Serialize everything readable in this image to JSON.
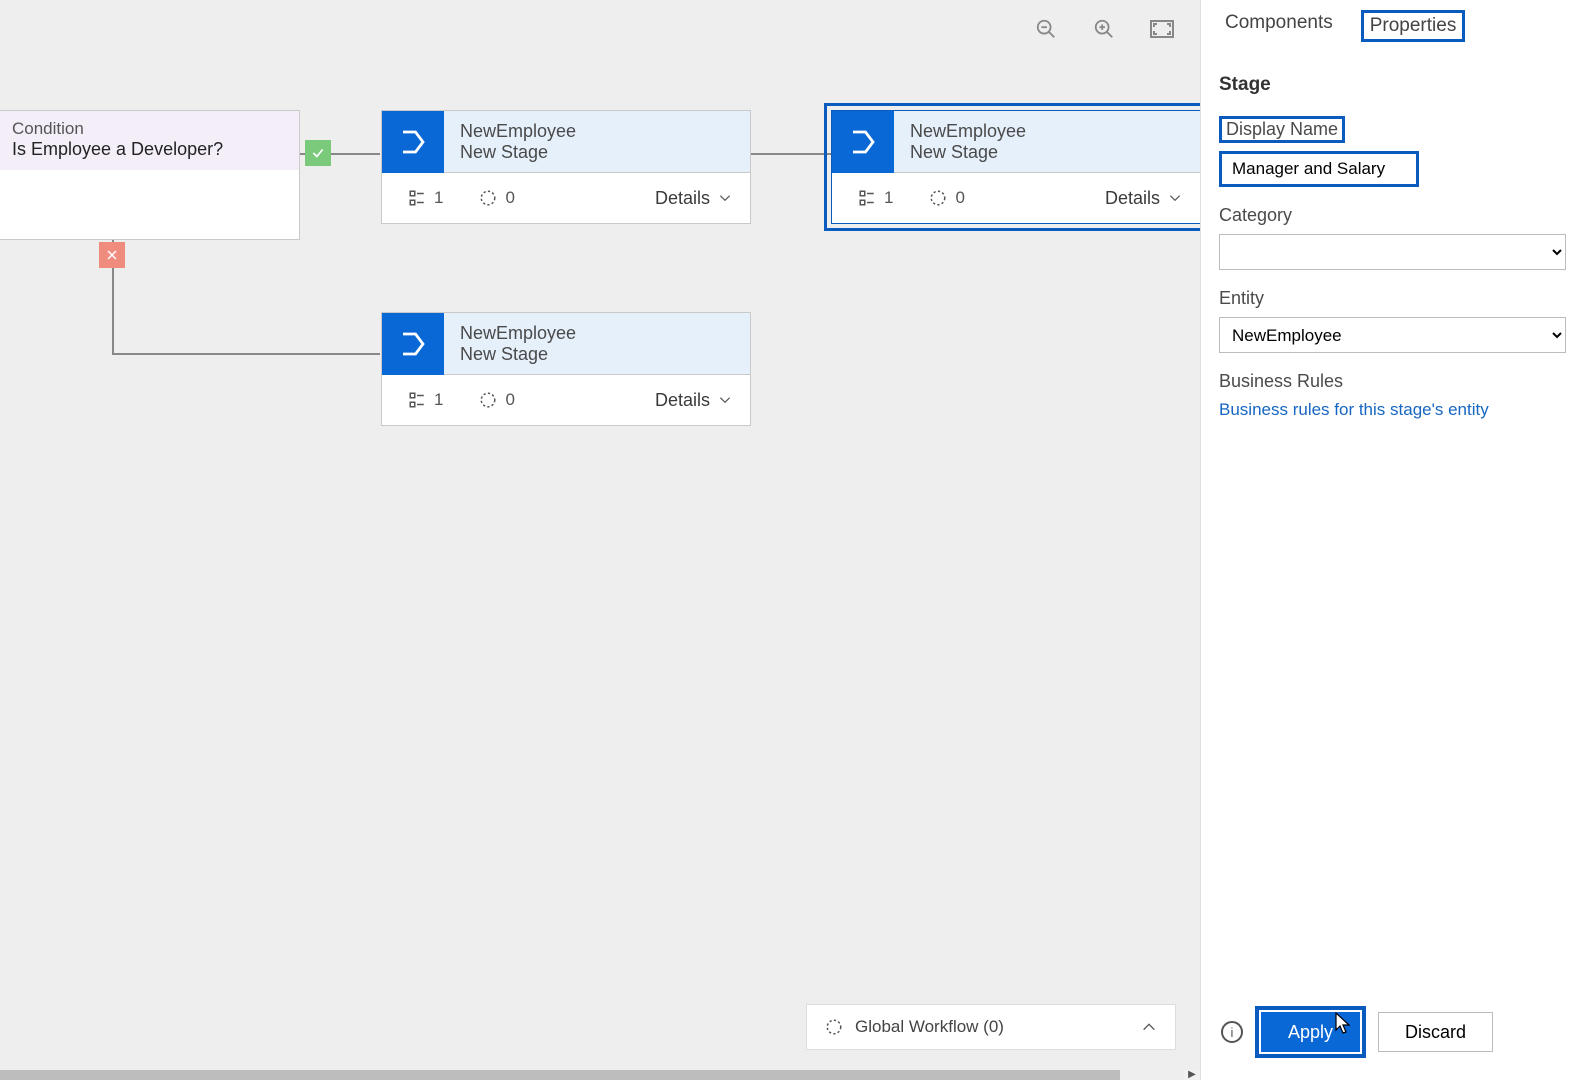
{
  "toolbar": {
    "zoom_out": "zoom-out",
    "zoom_in": "zoom-in",
    "fit": "fit-to-screen"
  },
  "condition": {
    "label": "Condition",
    "text": "Is Employee a Developer?"
  },
  "stages": {
    "s1": {
      "entity": "NewEmployee",
      "name": "New Stage",
      "steps": "1",
      "triggers": "0",
      "details": "Details"
    },
    "s2": {
      "entity": "NewEmployee",
      "name": "New Stage",
      "steps": "1",
      "triggers": "0",
      "details": "Details"
    },
    "s3": {
      "entity": "NewEmployee",
      "name": "New Stage",
      "steps": "1",
      "triggers": "0",
      "details": "Details"
    }
  },
  "global_workflow": {
    "label": "Global Workflow (0)"
  },
  "panel": {
    "tabs": {
      "components": "Components",
      "properties": "Properties"
    },
    "section": "Stage",
    "display_name_label": "Display Name",
    "display_name_value": "Manager and Salary",
    "category_label": "Category",
    "category_value": "",
    "entity_label": "Entity",
    "entity_value": "NewEmployee",
    "biz_label": "Business Rules",
    "biz_link": "Business rules for this stage's entity",
    "apply": "Apply",
    "discard": "Discard"
  }
}
